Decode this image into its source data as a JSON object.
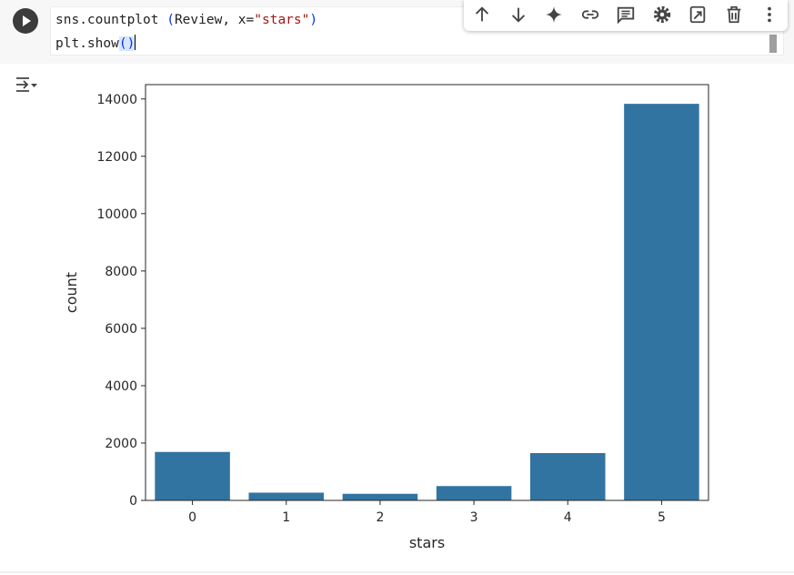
{
  "cell": {
    "code_line1": {
      "fn": "sns.countplot ",
      "open": "(",
      "args": "Review, x=",
      "str": "\"stars\"",
      "close": ")"
    },
    "code_line2": {
      "fn": "plt.show",
      "parens": "()"
    }
  },
  "toolbar": {
    "icons": [
      "arrow-up-icon",
      "arrow-down-icon",
      "sparkle-icon",
      "link-icon",
      "comment-icon",
      "gear-icon",
      "mirror-cell-icon",
      "trash-icon",
      "more-vert-icon"
    ]
  },
  "colors": {
    "bar": "#3274a1",
    "axis": "#262626"
  },
  "chart_data": {
    "type": "bar",
    "categories": [
      "0",
      "1",
      "2",
      "3",
      "4",
      "5"
    ],
    "values": [
      1690,
      270,
      230,
      500,
      1650,
      13830
    ],
    "xlabel": "stars",
    "ylabel": "count",
    "ylim": [
      0,
      14500
    ],
    "yticks": [
      0,
      2000,
      4000,
      6000,
      8000,
      10000,
      12000,
      14000
    ],
    "yticklabels": [
      "0",
      "2000",
      "4000",
      "6000",
      "8000",
      "10000",
      "12000",
      "14000"
    ],
    "grid": false
  }
}
